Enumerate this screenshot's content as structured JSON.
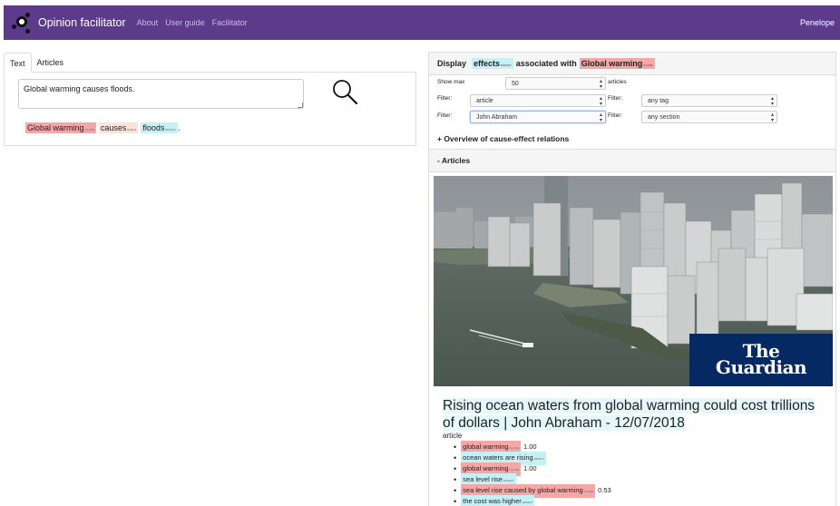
{
  "navbar": {
    "brand": "Opinion facilitator",
    "links": [
      "About",
      "User guide",
      "Facilitator"
    ],
    "user": "Penelope",
    "colors": {
      "background": "#5c3c8a"
    }
  },
  "left": {
    "tabs": [
      "Text",
      "Articles"
    ],
    "text_input_value": "Global warming causes floods.",
    "search_icon": "search-icon",
    "parsed": {
      "cause": "Global warming",
      "cause_tag": "CAUSE",
      "event": "causes",
      "event_tag": "EVENT",
      "effect": "floods",
      "effect_tag": "EFFECT",
      "period": "."
    }
  },
  "right": {
    "header": {
      "prefix": "Display",
      "effects": "effects",
      "effects_tag": "EFFECT",
      "middle": "associated with",
      "cause": "Global warming",
      "cause_tag": "CAUSE"
    },
    "show_max_label": "Show max",
    "show_max_value": "50",
    "articles_suffix": "articles",
    "filter_label": "Filter:",
    "filters": {
      "type": "article",
      "tag": "any tag",
      "author": "John Abraham",
      "section": "any section"
    },
    "overview_label": "+ Overview of cause-effect relations",
    "articles_label": "- Articles"
  },
  "article": {
    "publisher": "The Guardian",
    "publisher_line1": "The",
    "publisher_line2": "Guardian",
    "title": "Rising ocean waters from global warming could cost trillions of dollars | John Abraham - 12/07/2018",
    "type": "article",
    "items": [
      {
        "text": "global warming",
        "tag": "CAUSE",
        "kind": "cause",
        "score": "1.00"
      },
      {
        "text": "ocean waters are rising",
        "tag": "EFFECT",
        "kind": "effect",
        "score": ""
      },
      {
        "text": "global warming",
        "tag": "CAUSE",
        "kind": "cause",
        "score": "1.00"
      },
      {
        "text": "sea level rise",
        "tag": "EFFECT",
        "kind": "effect",
        "score": ""
      },
      {
        "text": "sea level rise caused by global warming",
        "tag": "CAUSE",
        "kind": "cause",
        "score": "0.53"
      },
      {
        "text": "the cost was higher",
        "tag": "EFFECT",
        "kind": "effect",
        "score": ""
      }
    ]
  },
  "colors": {
    "cause": "#f4a7a7",
    "event": "#fbe3dc",
    "effect": "#c6f0f4",
    "guardian": "#052962"
  }
}
